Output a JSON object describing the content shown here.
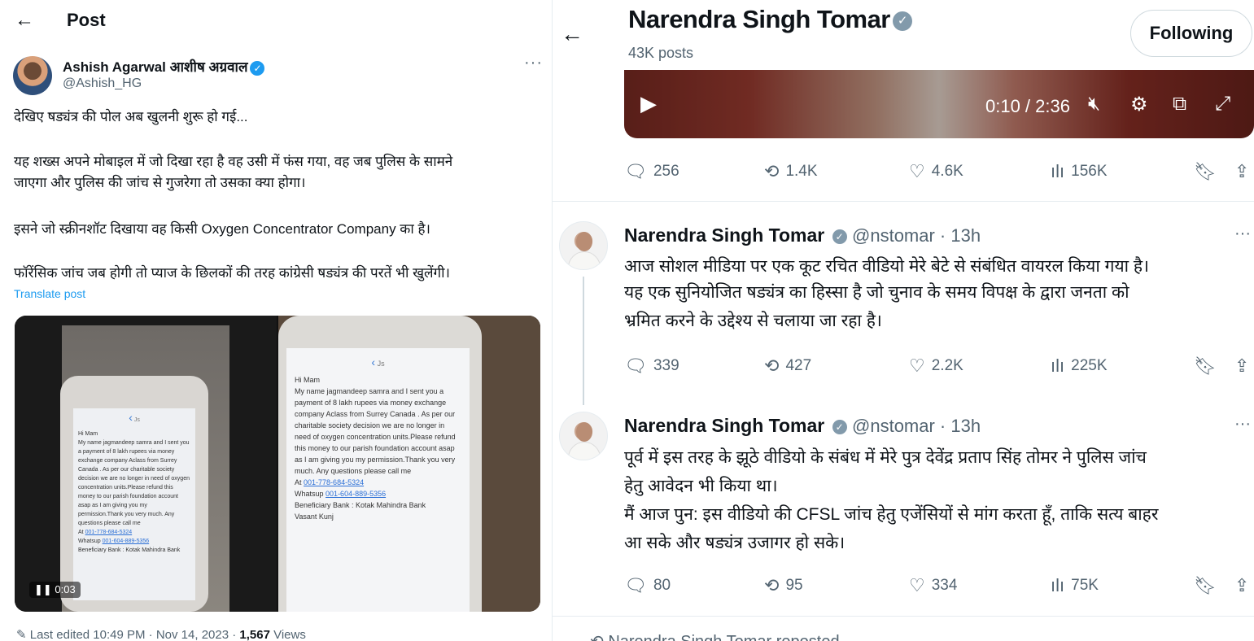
{
  "left": {
    "header_title": "Post",
    "author_name": "Ashish Agarwal आशीष अग्रवाल",
    "author_handle": "@Ashish_HG",
    "more": "···",
    "paragraphs": [
      "देखिए षड्यंत्र की पोल अब खुलनी शुरू हो गई...",
      "यह शख्स अपने मोबाइल में जो दिखा रहा है वह उसी में फंस गया, वह जब पुलिस के सामने",
      "जाएगा और पुलिस की जांच से गुजरेगा तो उसका क्या होगा।",
      "इसने जो स्क्रीनशॉट दिखाया वह किसी Oxygen Concentrator Company का है।",
      "फॉरेंसिक जांच जब होगी तो प्याज के छिलकों की तरह कांग्रेसी षड्यंत्र की परतें भी खुलेंगी।"
    ],
    "translate": "Translate post",
    "video_time": "0:03",
    "email": {
      "greeting": "Hi Mam",
      "from": "Js",
      "body": "My name jagmandeep samra and I sent you a payment of 8 lakh rupees via money exchange company Aclass from Surrey Canada . As per our charitable society decision we are no longer in need of oxygen concentration units.Please refund this money to our parish foundation account asap as I am giving you my permission.Thank you very much. Any questions please call me",
      "phone_label": "At",
      "phone": "001-778-684-5324",
      "whatsapp_label": "Whatsup",
      "whatsapp": "001-604-889-5356",
      "bank": "Beneficiary Bank : Kotak Mahindra Bank",
      "branch": "Vasant Kunj"
    },
    "footer_prefix": "Last edited 10:49 PM · Nov 14, 2023 · ",
    "footer_views": "1,567",
    "footer_suffix": " Views"
  },
  "right": {
    "profile_name": "Narendra Singh Tomar",
    "posts_count": "43K posts",
    "follow_label": "Following",
    "video": {
      "time": "0:10 / 2:36"
    },
    "tweet0_stats": {
      "replies": "256",
      "reposts": "1.4K",
      "likes": "4.6K",
      "views": "156K"
    },
    "tweets": [
      {
        "name": "Narendra Singh Tomar",
        "handle_time": "@nstomar · 13h",
        "lines": [
          "आज सोशल मीडिया पर एक कूट रचित वीडियो मेरे बेटे से संबंधित वायरल किया गया है।",
          "यह एक सुनियोजित षड्यंत्र का हिस्सा है जो चुनाव के समय विपक्ष के द्वारा जनता को",
          "भ्रमित करने के उद्देश्य से चलाया जा रहा है।"
        ],
        "stats": {
          "replies": "339",
          "reposts": "427",
          "likes": "2.2K",
          "views": "225K"
        }
      },
      {
        "name": "Narendra Singh Tomar",
        "handle_time": "@nstomar · 13h",
        "lines": [
          "पूर्व में इस तरह के झूठे वीडियो के संबंध में मेरे पुत्र देवेंद्र प्रताप सिंह तोमर ने पुलिस जांच",
          "हेतु आवेदन भी किया था।",
          "मैं आज पुन: इस वीडियो की CFSL जांच हेतु एजेंसियों से मांग करता हूँ, ताकि सत्य बाहर",
          "आ सके और षड्यंत्र उजागर हो सके।"
        ],
        "stats": {
          "replies": "80",
          "reposts": "95",
          "likes": "334",
          "views": "75K"
        }
      }
    ],
    "repost_text": "Narendra Singh Tomar reposted"
  }
}
